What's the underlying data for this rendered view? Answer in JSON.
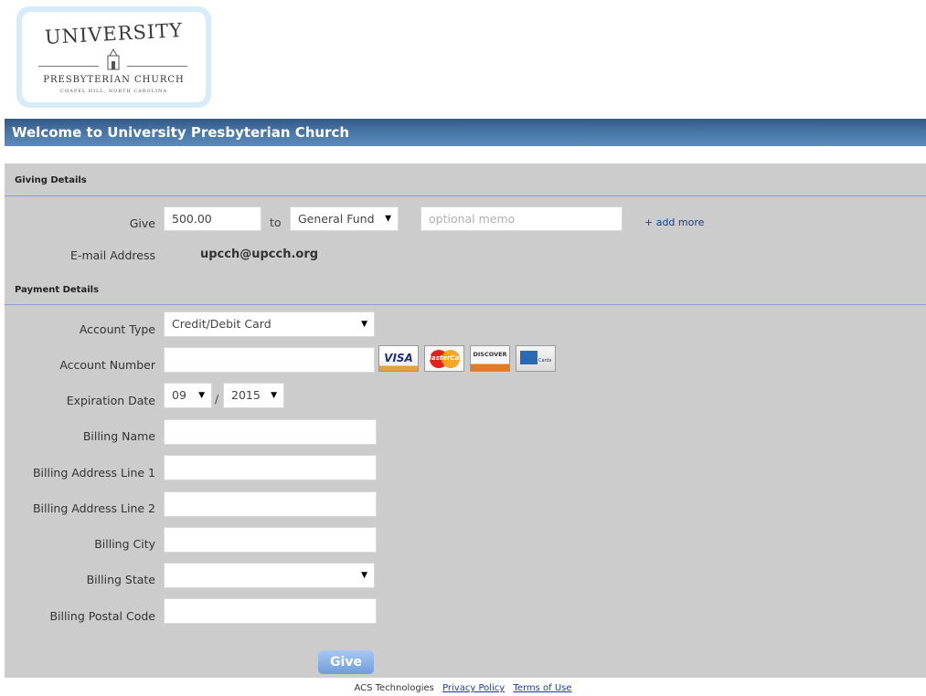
{
  "logo": {
    "title": "UNIVERSITY",
    "subtitle": "PRESBYTERIAN CHURCH",
    "location": "CHAPEL HILL, NORTH CAROLINA"
  },
  "banner": {
    "title": "Welcome to University Presbyterian Church"
  },
  "giving": {
    "section_title": "Giving Details",
    "give_label": "Give",
    "amount_value": "500.00",
    "to_label": "to",
    "fund_selected": "General Fund",
    "memo_placeholder": "optional memo",
    "add_more_label": "+ add more",
    "email_label": "E-mail Address",
    "email_value": "upcch@upcch.org"
  },
  "payment": {
    "section_title": "Payment Details",
    "account_type_label": "Account Type",
    "account_type_selected": "Credit/Debit Card",
    "account_number_label": "Account Number",
    "expiration_label": "Expiration Date",
    "exp_month_selected": "09",
    "exp_separator": "/",
    "exp_year_selected": "2015",
    "billing_name_label": "Billing Name",
    "billing_address1_label": "Billing Address Line 1",
    "billing_address2_label": "Billing Address Line 2",
    "billing_city_label": "Billing City",
    "billing_state_label": "Billing State",
    "billing_state_selected": "",
    "billing_postal_label": "Billing Postal Code",
    "cards": {
      "visa": "VISA",
      "mastercard": "MasterCard",
      "discover": "DISCOVER",
      "amex": "Cards"
    },
    "give_button": "Give"
  },
  "footer": {
    "company": "ACS Technologies",
    "privacy": "Privacy Policy",
    "terms": "Terms of Use"
  }
}
